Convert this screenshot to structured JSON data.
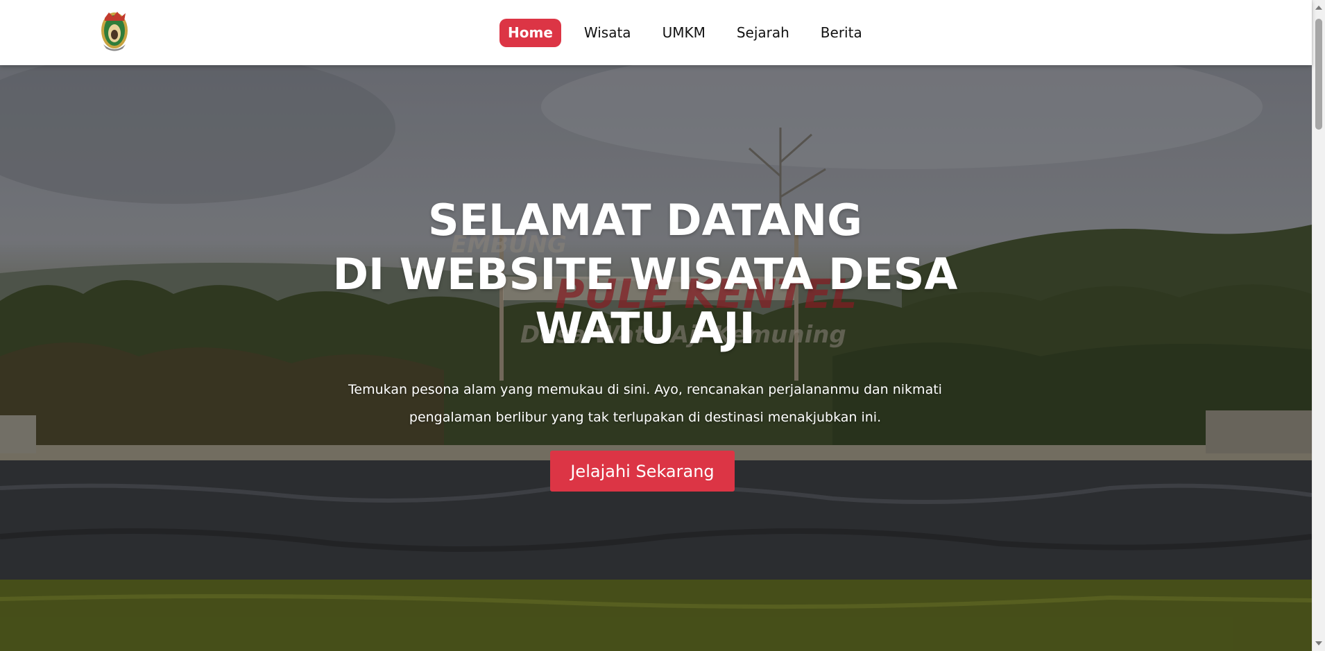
{
  "navbar": {
    "logo_icon": "village-emblem-logo",
    "items": [
      {
        "label": "Home",
        "active": true
      },
      {
        "label": "Wisata",
        "active": false
      },
      {
        "label": "UMKM",
        "active": false
      },
      {
        "label": "Sejarah",
        "active": false
      },
      {
        "label": "Berita",
        "active": false
      }
    ]
  },
  "hero": {
    "title_lines": [
      "SELAMAT DATANG",
      "DI WEBSITE WISATA DESA",
      "WATU AJI"
    ],
    "subtitle": "Temukan pesona alam yang memukau di sini. Ayo, rencanakan perjalananmu dan nikmati pengalaman berlibur yang tak terlupakan di destinasi menakjubkan ini.",
    "cta_label": "Jelajahi Sekarang"
  },
  "colors": {
    "accent": "#dc3545",
    "nav_text": "#111111",
    "hero_text": "#ffffff"
  }
}
